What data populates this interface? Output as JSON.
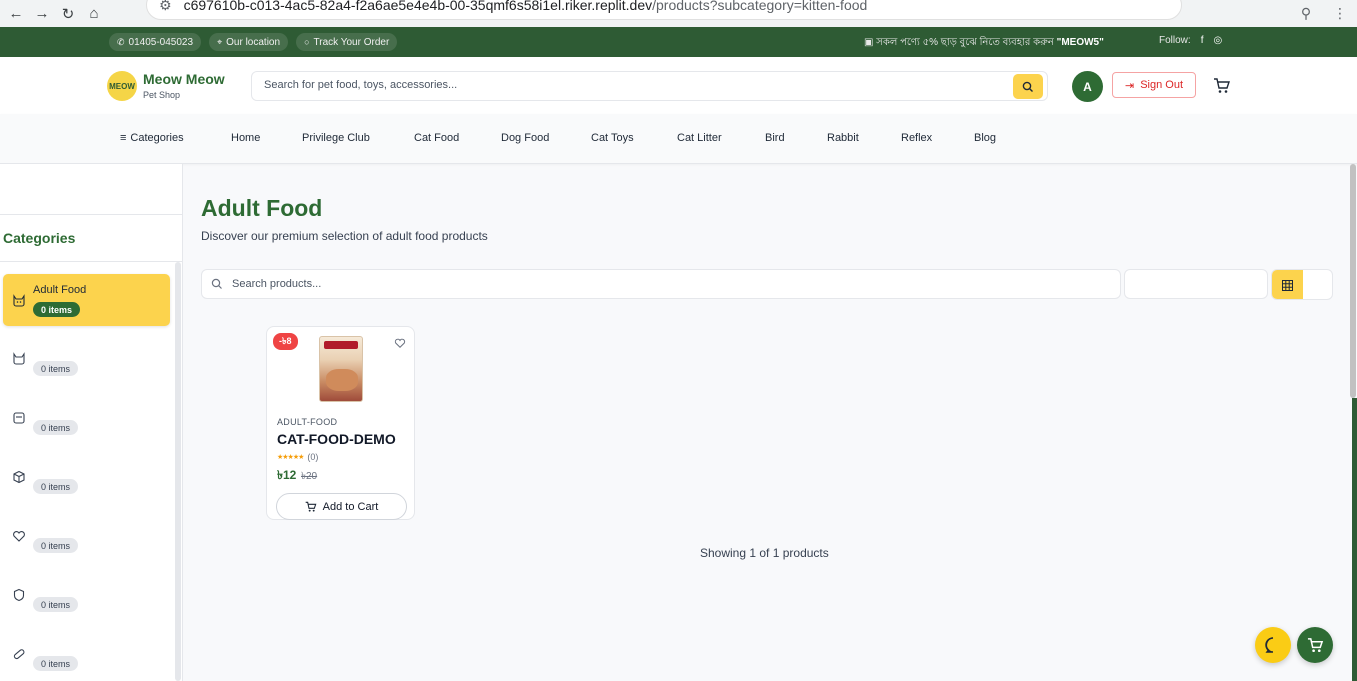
{
  "browser": {
    "url_host": "c697610b-c013-4ac5-82a4-f2a6ae5e4e4b-00-35qmf6s58i1el.riker.replit.dev",
    "url_path": "/products?subcategory=kitten-food"
  },
  "topbar": {
    "phone": "01405-045023",
    "location": "Our location",
    "track": "Track Your Order",
    "promo_text": "সকল পণ্যে ৫% ছাড় বুঝে নিতে ব্যবহার করুন",
    "promo_code": "\"MEOW5\"",
    "follow": "Follow:"
  },
  "header": {
    "brand_name": "Meow Meow",
    "brand_sub": "Pet Shop",
    "logo_text": "MEOW",
    "search_placeholder": "Search for pet food, toys, accessories...",
    "avatar_initial": "A",
    "signout_label": "Sign Out"
  },
  "nav": {
    "categories": "Categories",
    "items": [
      "Home",
      "Privilege Club",
      "Cat Food",
      "Dog Food",
      "Cat Toys",
      "Cat Litter",
      "Bird",
      "Rabbit",
      "Reflex",
      "Blog"
    ]
  },
  "sidebar": {
    "title": "Categories",
    "items": [
      {
        "label": "Adult Food",
        "count": "0 items",
        "icon": "cat-icon",
        "active": true
      },
      {
        "label": "",
        "count": "0 items",
        "icon": "cat-icon",
        "active": false
      },
      {
        "label": "",
        "count": "0 items",
        "icon": "package-icon",
        "active": false
      },
      {
        "label": "",
        "count": "0 items",
        "icon": "box-icon",
        "active": false
      },
      {
        "label": "",
        "count": "0 items",
        "icon": "heart-icon",
        "active": false
      },
      {
        "label": "",
        "count": "0 items",
        "icon": "shield-icon",
        "active": false
      },
      {
        "label": "",
        "count": "0 items",
        "icon": "pill-icon",
        "active": false
      }
    ]
  },
  "main": {
    "title": "Adult Food",
    "subtitle": "Discover our premium selection of adult food products",
    "search_placeholder": "Search products...",
    "showing": "Showing 1 of 1 products"
  },
  "product": {
    "discount": "-৳8",
    "category": "ADULT-FOOD",
    "name": "CAT-FOOD-DEMO",
    "rating_count": "(0)",
    "rating": 5,
    "price": "৳12",
    "old_price": "৳20",
    "add_to_cart": "Add to Cart"
  },
  "colors": {
    "brand_green": "#2e6b34",
    "accent_yellow": "#fcd34d",
    "discount_red": "#ef4444"
  }
}
